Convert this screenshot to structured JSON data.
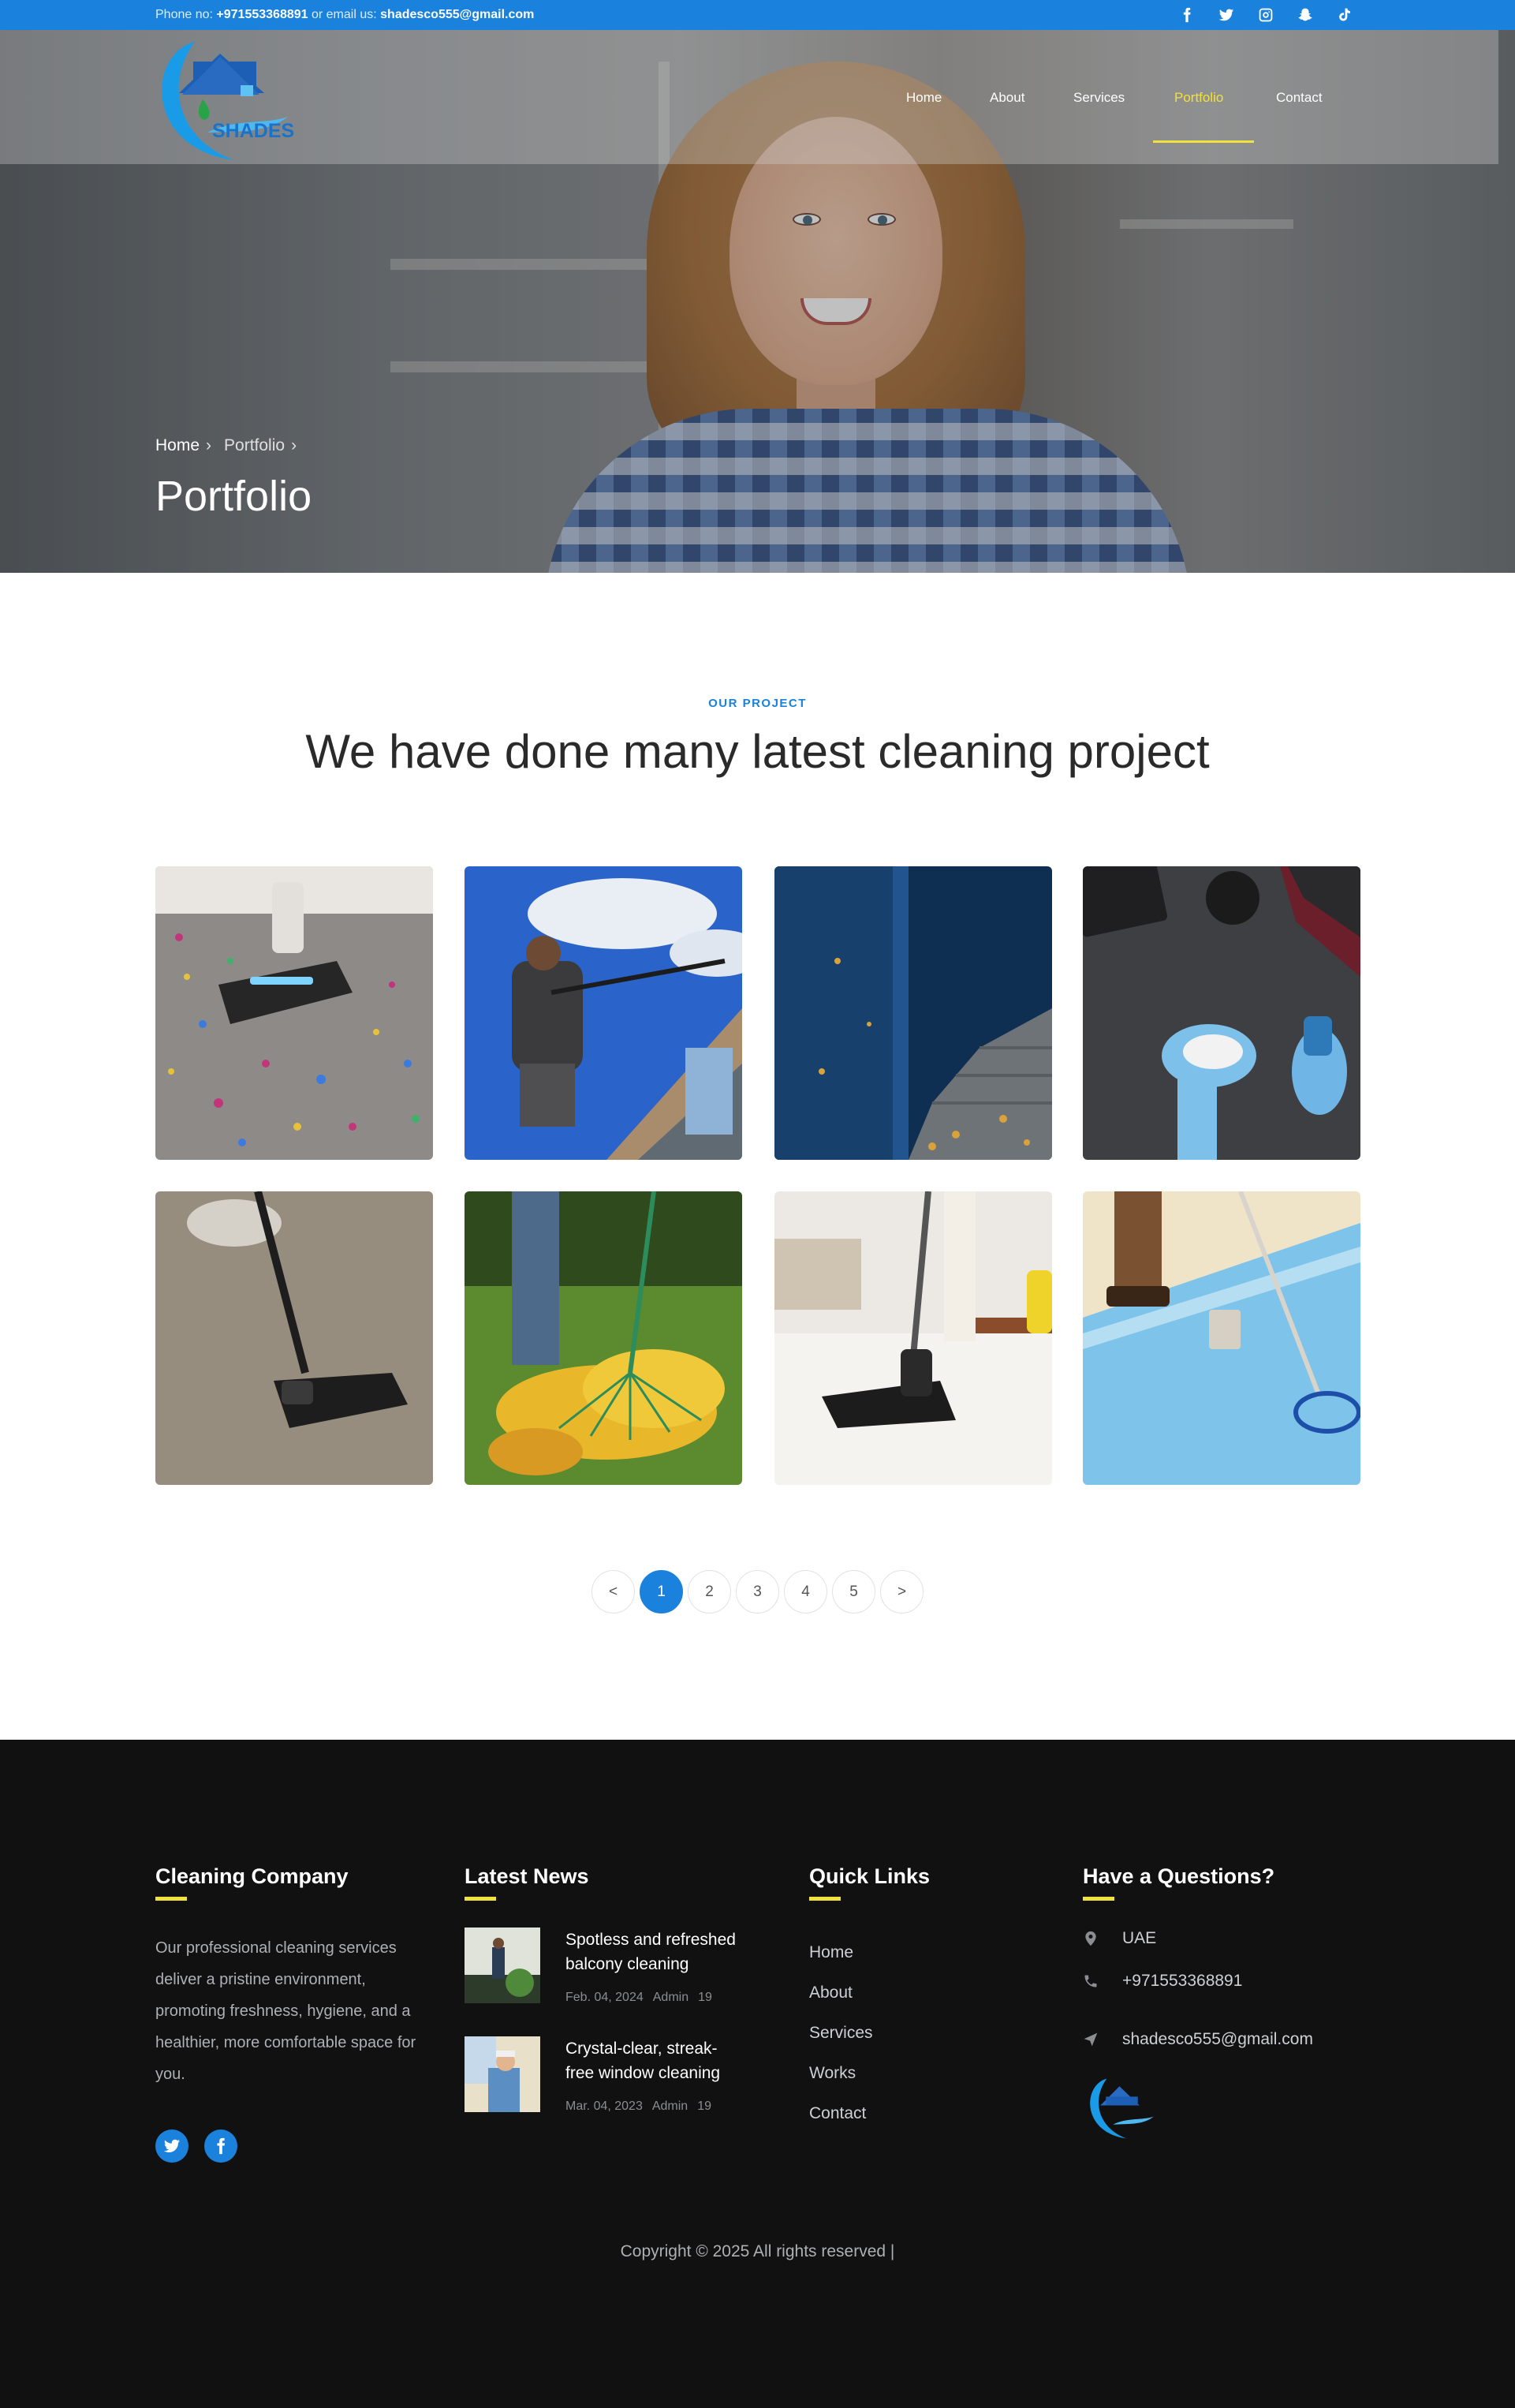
{
  "topbar": {
    "phone_label": "Phone no:",
    "phone": "+971553368891",
    "email_label": "or email us:",
    "email": "shadesco555@gmail.com",
    "social_icons": [
      "facebook-icon",
      "twitter-icon",
      "instagram-icon",
      "snapchat-icon",
      "tiktok-icon"
    ]
  },
  "brand": {
    "logo_text": "SHADES"
  },
  "nav": {
    "items": [
      {
        "label": "Home"
      },
      {
        "label": "About"
      },
      {
        "label": "Services"
      },
      {
        "label": "Portfolio"
      },
      {
        "label": "Contact"
      }
    ],
    "active": "Portfolio",
    "accent_color": "#f1e13c"
  },
  "hero": {
    "breadcrumb": [
      "Home",
      "Portfolio"
    ],
    "title": "Portfolio"
  },
  "project": {
    "eyebrow": "OUR PROJECT",
    "title": "We have done many latest cleaning project",
    "tiles": [
      "carpet-vacuum-confetti",
      "window-washing-house",
      "blue-wall-steps-leaves",
      "gloved-hand-wiping-desk",
      "vacuum-on-rug",
      "rake-autumn-leaves",
      "vacuum-white-rug",
      "pool-skimmer"
    ]
  },
  "pagination": {
    "prev": "<",
    "pages": [
      "1",
      "2",
      "3",
      "4",
      "5"
    ],
    "next": ">",
    "current": "1",
    "accent_color": "#1a82dc"
  },
  "footer": {
    "about": {
      "heading": "Cleaning Company",
      "text": "Our professional cleaning services deliver a pristine environment, promoting freshness, hygiene, and a healthier, more comfortable space for you."
    },
    "news": {
      "heading": "Latest News",
      "items": [
        {
          "title": "Spotless and refreshed balcony cleaning",
          "date": "Feb. 04, 2024",
          "author": "Admin",
          "comments": "19"
        },
        {
          "title": "Crystal-clear, streak-free window cleaning",
          "date": "Mar. 04, 2023",
          "author": "Admin",
          "comments": "19"
        }
      ]
    },
    "links": {
      "heading": "Quick Links",
      "items": [
        "Home",
        "About",
        "Services",
        "Works",
        "Contact"
      ]
    },
    "contact": {
      "heading": "Have a Questions?",
      "location": "UAE",
      "phone": "+971553368891",
      "email": "shadesco555@gmail.com"
    },
    "copyright": "Copyright © 2025 All rights reserved |",
    "bg_color": "#111112"
  }
}
